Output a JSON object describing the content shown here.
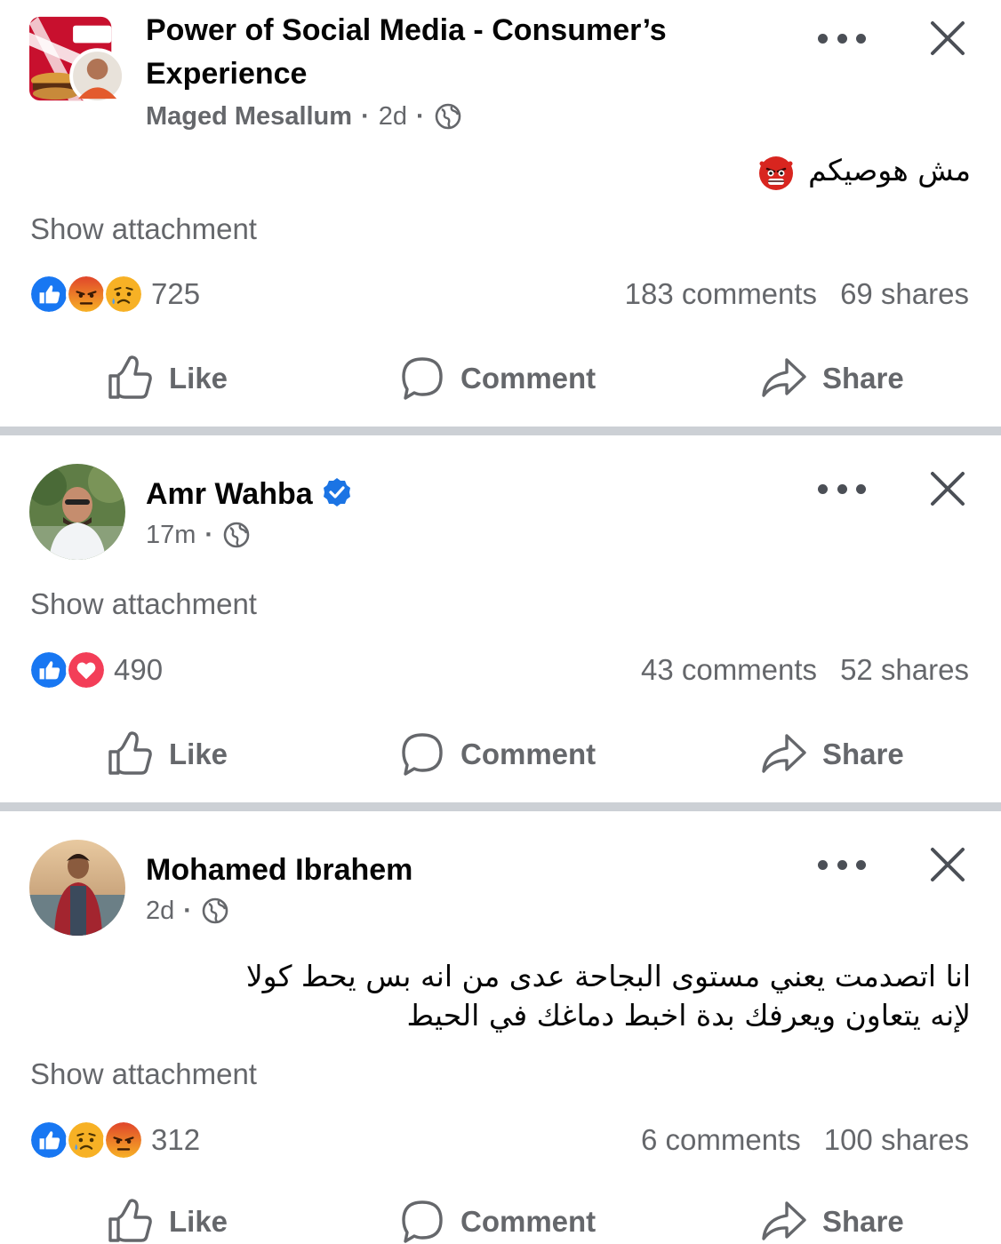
{
  "colors": {
    "like_blue": "#1877f2",
    "love_red": "#f33e58",
    "angry_orange": "#e9710f",
    "sad_yellow": "#f7b125",
    "secondary_text": "#65676b",
    "divider": "#ccd0d5",
    "verified_blue": "#1b74e4"
  },
  "actions": {
    "like": "Like",
    "comment": "Comment",
    "share": "Share"
  },
  "posts": [
    {
      "author": "Power of Social Media - Consumer’s",
      "author_line2": "Experience",
      "sub_author": "Maged Mesallum",
      "time": "2d",
      "sep": "·",
      "audience_icon": "globe-icon",
      "text": "مش هوصيكم",
      "text_emoji": "ogre-emoji",
      "attachment": "Show attachment",
      "reactions": [
        "like",
        "angry",
        "sad"
      ],
      "reaction_count": "725",
      "comments": "183 comments",
      "shares": "69 shares"
    },
    {
      "author": "Amr Wahba",
      "verified": true,
      "time": "17m",
      "sep": "·",
      "audience_icon": "globe-icon",
      "attachment": "Show attachment",
      "reactions": [
        "like",
        "love"
      ],
      "reaction_count": "490",
      "comments": "43 comments",
      "shares": "52 shares"
    },
    {
      "author": "Mohamed Ibrahem",
      "time": "2d",
      "sep": "·",
      "audience_icon": "globe-icon",
      "text_line1": "انا اتصدمت يعني مستوى البجاحة عدى من انه بس يحط كولا",
      "text_line2": "لإنه يتعاون ويعرفك بدة اخبط دماغك في الحيط",
      "attachment": "Show attachment",
      "reactions": [
        "like",
        "sad",
        "angry"
      ],
      "reaction_count": "312",
      "comments": "6 comments",
      "shares": "100 shares"
    }
  ]
}
